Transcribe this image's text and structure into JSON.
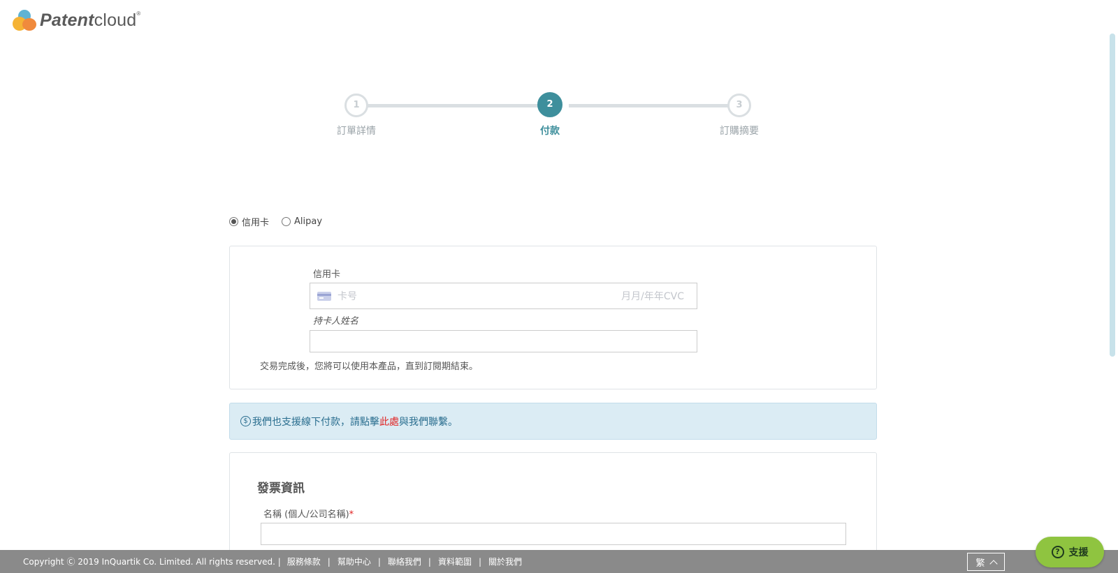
{
  "brand": {
    "bold": "Patent",
    "light": "cloud",
    "reg": "®"
  },
  "stepper": {
    "steps": [
      {
        "number": "1",
        "label": "訂單詳情"
      },
      {
        "number": "2",
        "label": "付款"
      },
      {
        "number": "3",
        "label": "訂購摘要"
      }
    ],
    "active_step": 2
  },
  "payment_methods": {
    "options": [
      {
        "label": "信用卡",
        "selected": true
      },
      {
        "label": "Alipay",
        "selected": false
      }
    ]
  },
  "card_form": {
    "card_label": "信用卡",
    "card_number_placeholder": "卡号",
    "expiry_cvc_placeholder": "月月/年年CVC",
    "holder_label": "持卡人姓名",
    "holder_value": "",
    "note": "交易完成後，您將可以使用本產品，直到訂閱期結束。"
  },
  "offline_banner": {
    "icon": "dollar-circle-icon",
    "text_before": "我們也支援線下付款，請點擊",
    "link_text": "此處",
    "text_after": "與我們聯繫。"
  },
  "invoice": {
    "title": "發票資訊",
    "name_label": "名稱 (個人/公司名稱)",
    "required_mark": "*",
    "name_value": ""
  },
  "footer": {
    "copyright": "Copyright Ⓒ 2019 InQuartik Co. Limited. All rights reserved. |",
    "links": [
      "服務條款",
      "幫助中心",
      "聯絡我們",
      "資料範圍",
      "關於我們"
    ],
    "separator": "|",
    "language": "繁"
  },
  "support_button": {
    "icon": "question-circle-icon",
    "label": "支援"
  },
  "colors": {
    "accent": "#3e8f9c",
    "banner_bg": "#dbecf4",
    "footer_bg": "#8a8a8a",
    "support_bg": "#8fc440",
    "link_red": "#e02020"
  }
}
